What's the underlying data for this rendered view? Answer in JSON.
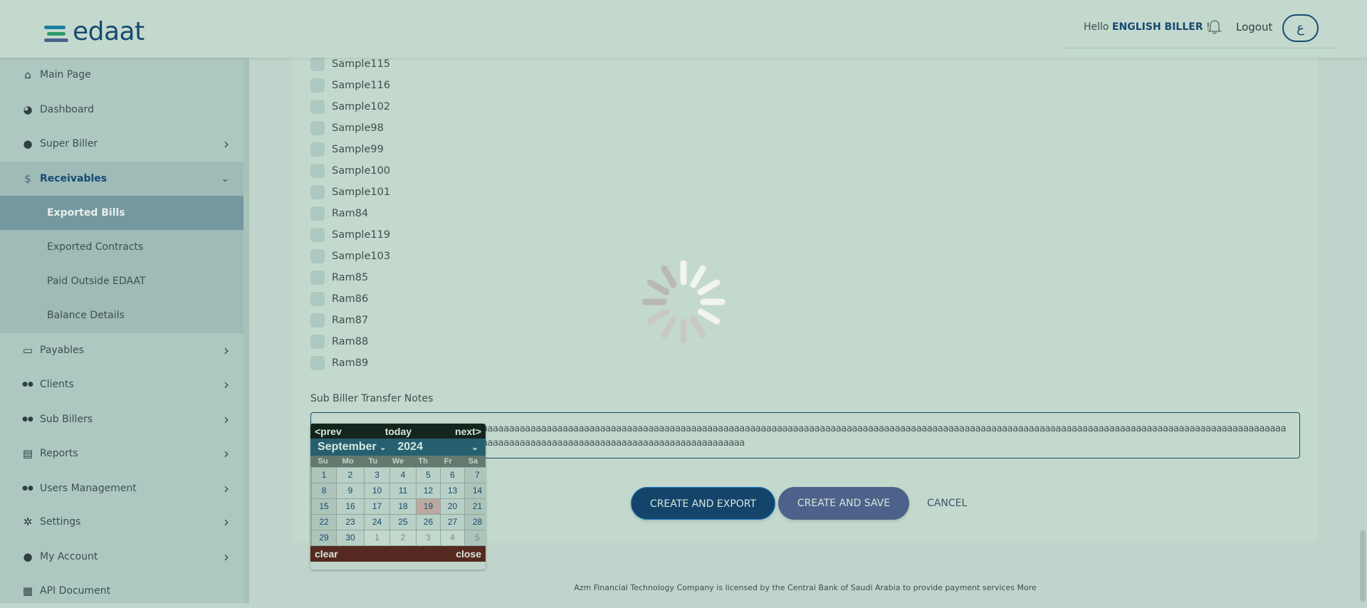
{
  "header": {
    "logo_text": "edaat",
    "greeting": "Hello",
    "user_name": "ENGLISH BILLER",
    "exclaim": "!",
    "logout": "Logout",
    "language_button": "ع",
    "brand_colors": [
      "#1a7fa0",
      "#2e9a6a",
      "#4d628a"
    ]
  },
  "sidebar": {
    "items": [
      {
        "label": "Main Page",
        "icon": "home-icon"
      },
      {
        "label": "Dashboard",
        "icon": "pie-chart-icon"
      },
      {
        "label": "Super Biller",
        "icon": "user-icon"
      },
      {
        "label": "Receivables",
        "icon": "hand-dollar-icon"
      },
      {
        "label": "Payables",
        "icon": "credit-card-icon"
      },
      {
        "label": "Clients",
        "icon": "users-icon"
      },
      {
        "label": "Sub Billers",
        "icon": "users-icon"
      },
      {
        "label": "Reports",
        "icon": "document-icon"
      },
      {
        "label": "Users Management",
        "icon": "users-icon"
      },
      {
        "label": "Settings",
        "icon": "gears-icon"
      },
      {
        "label": "My Account",
        "icon": "user-icon"
      },
      {
        "label": "API Document",
        "icon": "book-icon"
      }
    ],
    "receivables_sub": [
      {
        "label": "Exported Bills",
        "active": true
      },
      {
        "label": "Exported Contracts"
      },
      {
        "label": "Paid Outside EDAAT"
      },
      {
        "label": "Balance Details"
      }
    ]
  },
  "checklist": [
    "Sample115",
    "Sample116",
    "Sample102",
    "Sample98",
    "Sample99",
    "Sample100",
    "Sample101",
    "Ram84",
    "Sample119",
    "Sample103",
    "Ram85",
    "Ram86",
    "Ram87",
    "Ram88",
    "Ram89"
  ],
  "notes": {
    "label": "Sub Biller Transfer Notes",
    "value": "aaaaaaaaaaaaaaaaaaaaaaaaaaaaaaaaaaaaaaaaaaaaaaaaaaaaaaaaaaaaaaaaaaaaaaaaaaaaaaaaaaaaaaaaaaaaaaaaaaaaaaaaaaaaaaaaaaaaaaaaaaaaaaaaaaaaaaaaaaaaaaaaaaaaaaaaaaaaaaaaaaaaaaaaaaaaaaaaaaaaaaaaaaaaaaaaaaaaaaaaaaaaaaaaaaaaaaaaaaaaaaaaaaaaaaaaaaaaaaaaaaaaaaaaaaaaaaaaaaa"
  },
  "calendar": {
    "prev": "<prev",
    "today": "today",
    "next": "next>",
    "month": "September",
    "year": "2024",
    "dow": [
      "Su",
      "Mo",
      "Tu",
      "We",
      "Th",
      "Fr",
      "Sa"
    ],
    "days": [
      "1",
      "2",
      "3",
      "4",
      "5",
      "6",
      "7",
      "8",
      "9",
      "10",
      "11",
      "12",
      "13",
      "14",
      "15",
      "16",
      "17",
      "18",
      "19",
      "20",
      "21",
      "22",
      "23",
      "24",
      "25",
      "26",
      "27",
      "28",
      "29",
      "30",
      "1",
      "2",
      "3",
      "4",
      "5"
    ],
    "selected": "19",
    "clear": "clear",
    "close": "close"
  },
  "actions": {
    "create_export": "CREATE AND EXPORT",
    "create_save": "CREATE AND SAVE",
    "cancel": "CANCEL"
  },
  "footer": "Azm Financial Technology Company is licensed by the Central Bank of Saudi Arabia to provide payment services More"
}
